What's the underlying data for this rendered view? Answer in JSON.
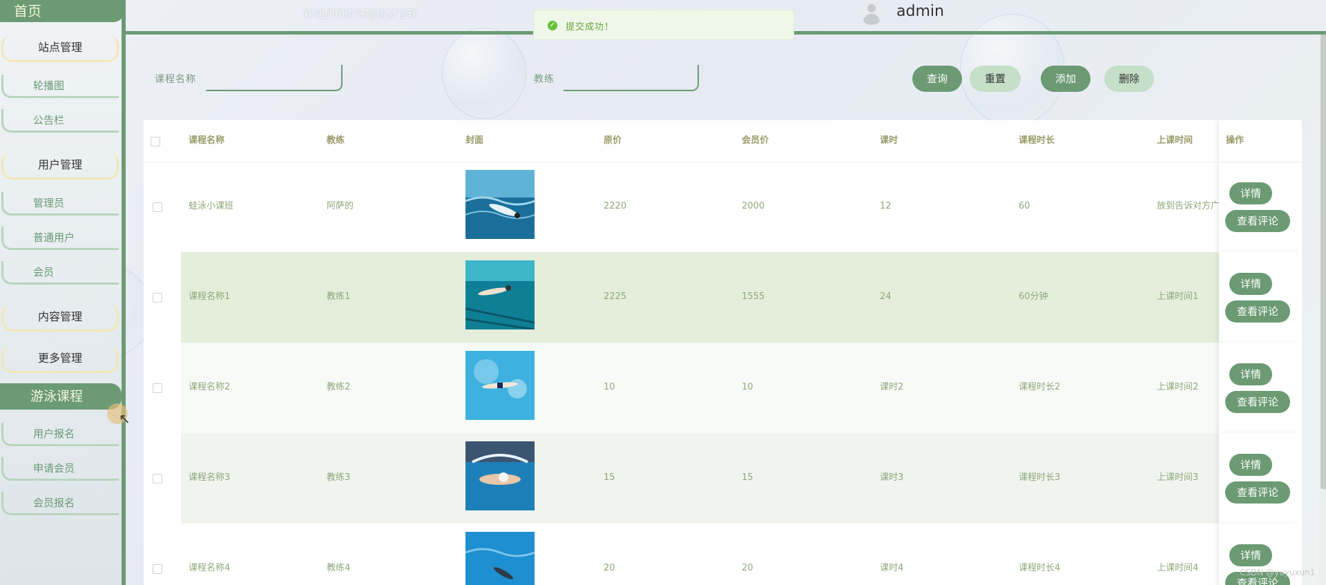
{
  "sidebar": {
    "home": "首页",
    "groups": [
      {
        "label": "站点管理",
        "items": [
          "轮播图",
          "公告栏"
        ]
      },
      {
        "label": "用户管理",
        "items": [
          "管理员",
          "普通用户",
          "会员"
        ]
      },
      {
        "label": "内容管理",
        "items": []
      },
      {
        "label": "更多管理",
        "items": []
      }
    ],
    "active": "游泳课程",
    "after_active": [
      "用户报名",
      "申请会员",
      "会员报名"
    ]
  },
  "header": {
    "welcome": "欢迎使用游泳馆信息管理",
    "username": "admin",
    "toast": "提交成功！"
  },
  "search": {
    "course_label": "课程名称",
    "course_value": "",
    "coach_label": "教练",
    "coach_value": "",
    "query": "查询",
    "reset": "重置",
    "add": "添加",
    "delete": "删除"
  },
  "table": {
    "columns": [
      "课程名称",
      "教练",
      "封面",
      "原价",
      "会员价",
      "课时",
      "课程时长",
      "上课时间",
      "操作"
    ],
    "rows": [
      {
        "name": "蛙泳小课班",
        "coach": "阿萨的",
        "price": "2220",
        "member_price": "2000",
        "hours": "12",
        "duration": "60",
        "time": "放到告诉对方广"
      },
      {
        "name": "课程名称1",
        "coach": "教练1",
        "price": "2225",
        "member_price": "1555",
        "hours": "24",
        "duration": "60分钟",
        "time": "上课时间1"
      },
      {
        "name": "课程名称2",
        "coach": "教练2",
        "price": "10",
        "member_price": "10",
        "hours": "课时2",
        "duration": "课程时长2",
        "time": "上课时间2"
      },
      {
        "name": "课程名称3",
        "coach": "教练3",
        "price": "15",
        "member_price": "15",
        "hours": "课时3",
        "duration": "课程时长3",
        "time": "上课时间3"
      },
      {
        "name": "课程名称4",
        "coach": "教练4",
        "price": "20",
        "member_price": "20",
        "hours": "课时4",
        "duration": "课程时长4",
        "time": "上课时间4"
      }
    ],
    "detail_label": "详情",
    "comments_label": "查看评论"
  },
  "watermark": "CSDN @yuyuxun1",
  "colors": {
    "accent": "#6b9a73",
    "accent_light": "#c5dfc8",
    "toast_bg": "#eff7e8",
    "row_highlight": "#e4eeda"
  }
}
